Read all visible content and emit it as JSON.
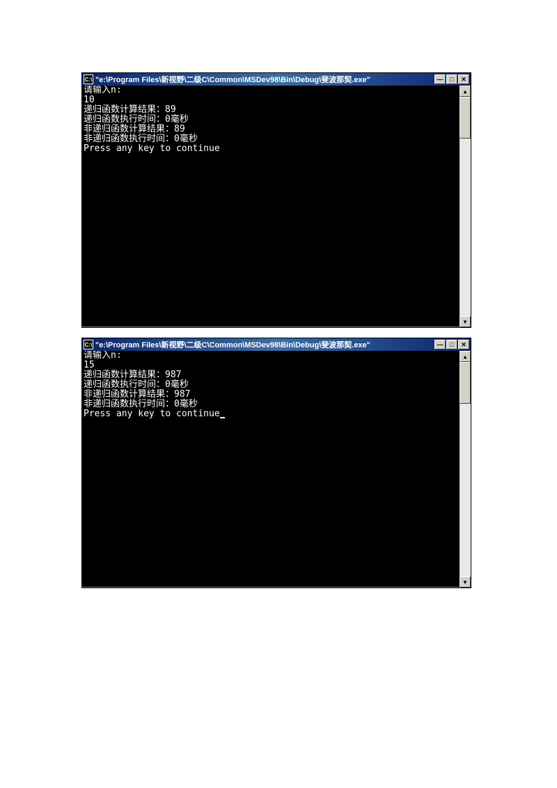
{
  "window1": {
    "title": "\"e:\\Program Files\\新视野\\二级C\\Common\\MSDev98\\Bin\\Debug\\斐波那契.exe\"",
    "icon_text": "C:\\",
    "lines": {
      "l0": "请输入n:",
      "l1": "10",
      "l2": "递归函数计算结果：89",
      "l3": "递归函数执行时间：0毫秒",
      "l4": "非递归函数计算结果：89",
      "l5": "非递归函数执行时间：0毫秒",
      "l6": "Press any key to continue"
    }
  },
  "window2": {
    "title": "\"e:\\Program Files\\新视野\\二级C\\Common\\MSDev98\\Bin\\Debug\\斐波那契.exe\"",
    "icon_text": "C:\\",
    "lines": {
      "l0": "请输入n:",
      "l1": "15",
      "l2": "递归函数计算结果：987",
      "l3": "递归函数执行时间：0毫秒",
      "l4": "非递归函数计算结果：987",
      "l5": "非递归函数执行时间：0毫秒",
      "l6": "Press any key to continue"
    }
  },
  "buttons": {
    "minimize": "—",
    "maximize": "□",
    "close": "✕"
  },
  "scroll": {
    "up": "▲",
    "down": "▼"
  }
}
